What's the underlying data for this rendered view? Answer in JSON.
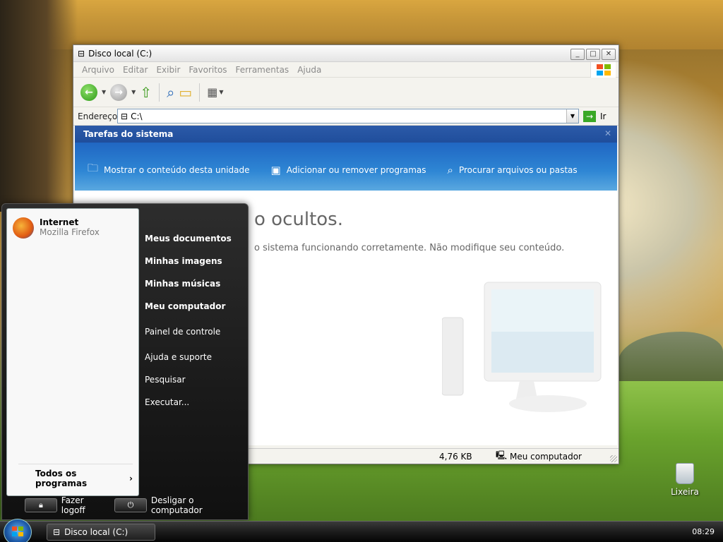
{
  "window": {
    "title": "Disco local (C:)",
    "menu": [
      "Arquivo",
      "Editar",
      "Exibir",
      "Favoritos",
      "Ferramentas",
      "Ajuda"
    ],
    "address_label": "Endereço",
    "address_value": "C:\\",
    "go_label": "Ir",
    "tasks_title": "Tarefas do sistema",
    "tasks": [
      {
        "label": "Mostrar o conteúdo desta unidade",
        "icon": "folder-icon"
      },
      {
        "label": "Adicionar ou remover programas",
        "icon": "programs-icon"
      },
      {
        "label": "Procurar arquivos ou pastas",
        "icon": "search-icon"
      }
    ],
    "heading": "o ocultos.",
    "subtext": "o sistema funcionando corretamente. Não modifique seu conteúdo.",
    "status_size": "4,76 KB",
    "status_location": "Meu computador"
  },
  "start_menu": {
    "pinned_title": "Internet",
    "pinned_subtitle": "Mozilla Firefox",
    "all_programs": "Todos os programas",
    "right_items": [
      {
        "label": "Meus documentos",
        "bold": true
      },
      {
        "label": "Minhas imagens",
        "bold": true
      },
      {
        "label": "Minhas músicas",
        "bold": true
      },
      {
        "label": "Meu computador",
        "bold": true
      },
      {
        "label": "Painel de controle",
        "bold": false
      },
      {
        "label": "Ajuda e suporte",
        "bold": false
      },
      {
        "label": "Pesquisar",
        "bold": false
      },
      {
        "label": "Executar...",
        "bold": false
      }
    ],
    "logoff": "Fazer logoff",
    "shutdown": "Desligar o computador"
  },
  "desktop": {
    "recycle_bin": "Lixeira"
  },
  "taskbar": {
    "button": "Disco local (C:)",
    "clock": "08:29"
  }
}
